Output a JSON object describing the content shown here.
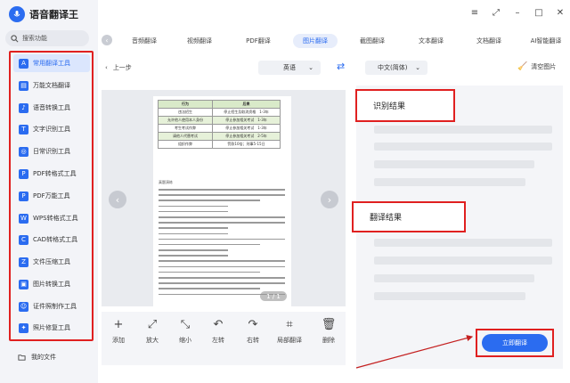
{
  "app": {
    "title": "语音翻译王",
    "brand_color": "#2b6cf0"
  },
  "window_controls": [
    "≡",
    "⤢",
    "–",
    "□",
    "✕"
  ],
  "search": {
    "placeholder": "搜索功能",
    "icon": "search-icon"
  },
  "sidebar": {
    "items": [
      {
        "label": "常用翻译工具",
        "icon": "translate-icon",
        "active": true
      },
      {
        "label": "万能文档翻译",
        "icon": "document-icon"
      },
      {
        "label": "语音转换工具",
        "icon": "voice-icon"
      },
      {
        "label": "文字识别工具",
        "icon": "text-recognition-icon"
      },
      {
        "label": "日常识别工具",
        "icon": "daily-recognition-icon"
      },
      {
        "label": "PDF转格式工具",
        "icon": "pdf-convert-icon"
      },
      {
        "label": "PDF万能工具",
        "icon": "pdf-tool-icon"
      },
      {
        "label": "WPS转格式工具",
        "icon": "wps-convert-icon"
      },
      {
        "label": "CAD转格式工具",
        "icon": "cad-convert-icon"
      },
      {
        "label": "文件压缩工具",
        "icon": "compress-icon"
      },
      {
        "label": "图片转换工具",
        "icon": "image-convert-icon"
      },
      {
        "label": "证件照制作工具",
        "icon": "id-photo-icon"
      },
      {
        "label": "照片修复工具",
        "icon": "photo-repair-icon"
      }
    ],
    "my_files": "我的文件"
  },
  "tabs": [
    "音频翻译",
    "视频翻译",
    "PDF翻译",
    "图片翻译",
    "截图翻译",
    "文本翻译",
    "文档翻译",
    "AI智能翻译"
  ],
  "active_tab": "图片翻译",
  "toolbar": {
    "back_label": "上一步",
    "source_lang": "英语",
    "target_lang": "中文(简体)",
    "clear_label": "清空图片"
  },
  "document": {
    "table_header": [
      "行为",
      "后果"
    ],
    "table_rows": [
      [
        "违法招生",
        "停止招生及取消资格　1-3年"
      ],
      [
        "允许他人使用本人身份",
        "停止参加相关考试　1-3年"
      ],
      [
        "考生考试作弊",
        "停止参加相关考试　1-3年"
      ],
      [
        "请他人代替考试",
        "停止参加相关考试　2-5年"
      ],
      [
        "组织作弊",
        "罚款10倍；刑事5-15日"
      ]
    ],
    "section_label": "真题演练",
    "page_indicator": "1 / 1"
  },
  "image_tools": [
    "添加",
    "放大",
    "缩小",
    "左转",
    "右转",
    "局部翻译",
    "删除"
  ],
  "results": {
    "recognition_title": "识别结果",
    "translation_title": "翻译结果",
    "translate_button": "立即翻译"
  }
}
